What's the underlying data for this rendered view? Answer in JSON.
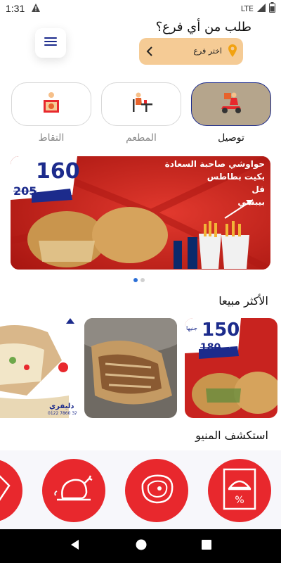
{
  "status_bar": {
    "time": "1:31",
    "network": "LTE"
  },
  "header": {
    "title": "طلب من أي فرع؟",
    "branch_placeholder": "اختر فرع"
  },
  "order_types": [
    {
      "label": "توصيل",
      "icon": "delivery-scooter-icon",
      "selected": true
    },
    {
      "label": "المطعم",
      "icon": "restaurant-dining-icon",
      "selected": false
    },
    {
      "label": "التقاط",
      "icon": "pickup-bag-icon",
      "selected": false
    }
  ],
  "banner": {
    "price": "160",
    "old_price": "205",
    "price_prefix": "بدل",
    "lines": [
      "حواوشي صاحبة السعادة",
      "بكيت بطاطس",
      "فل",
      "بيبسي"
    ],
    "indicator_count": 2,
    "active_index": 0
  },
  "best_sellers": {
    "title": "الأكثر مبيعا",
    "items": [
      {
        "name": "offer-150",
        "price": "150",
        "old_price": "180",
        "price_prefix": "بدل",
        "unit": "جنيها"
      },
      {
        "name": "hawawshi-meat"
      },
      {
        "name": "pizza-delivery",
        "caption": "دليفري",
        "phone": "0122 7860 32"
      }
    ]
  },
  "menu_section": {
    "title": "استكشف المنيو",
    "categories": [
      {
        "icon": "offers-cloche-icon"
      },
      {
        "icon": "meat-steak-icon"
      },
      {
        "icon": "chicken-roast-icon"
      },
      {
        "icon": "sandwich-icon"
      }
    ]
  },
  "colors": {
    "accent_red": "#e8282d",
    "branch_bg": "#f5cb95",
    "selected_type_bg": "#b5a58c",
    "selected_type_border": "#1c2b8c",
    "indicator_active": "#2c6fd6"
  }
}
